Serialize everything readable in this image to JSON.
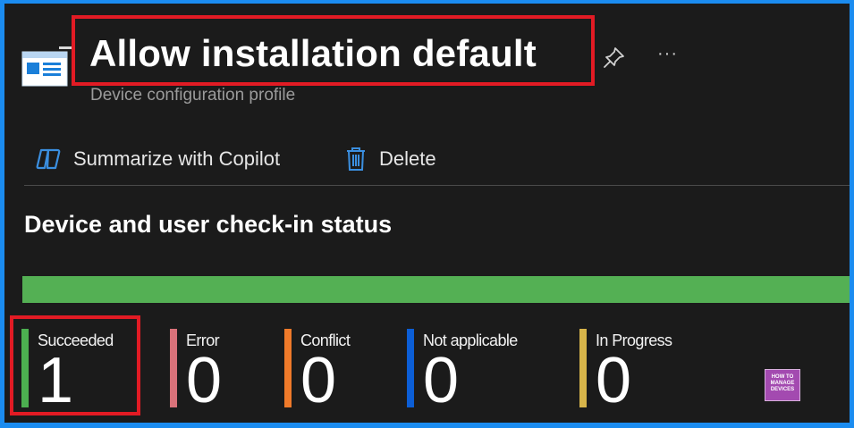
{
  "header": {
    "title": "Allow installation default",
    "subtitle": "Device configuration profile"
  },
  "commands": {
    "copilot_label": "Summarize with Copilot",
    "delete_label": "Delete"
  },
  "status": {
    "section_title": "Device and user check-in status",
    "bar_fraction_succeeded": 1.0,
    "items": [
      {
        "label": "Succeeded",
        "value": "1",
        "color": "#4caf50"
      },
      {
        "label": "Error",
        "value": "0",
        "color": "#d9727a"
      },
      {
        "label": "Conflict",
        "value": "0",
        "color": "#ef7a2a"
      },
      {
        "label": "Not applicable",
        "value": "0",
        "color": "#0c5ed6"
      },
      {
        "label": "In Progress",
        "value": "0",
        "color": "#d8b54a"
      }
    ]
  },
  "watermark": {
    "lines": [
      "HOW TO",
      "MANAGE",
      "DEVICES"
    ]
  },
  "colors": {
    "frame_border": "#1b8cf0",
    "background": "#1b1b1b",
    "highlight_box": "#e21b24",
    "bar_fill": "#54b054"
  }
}
